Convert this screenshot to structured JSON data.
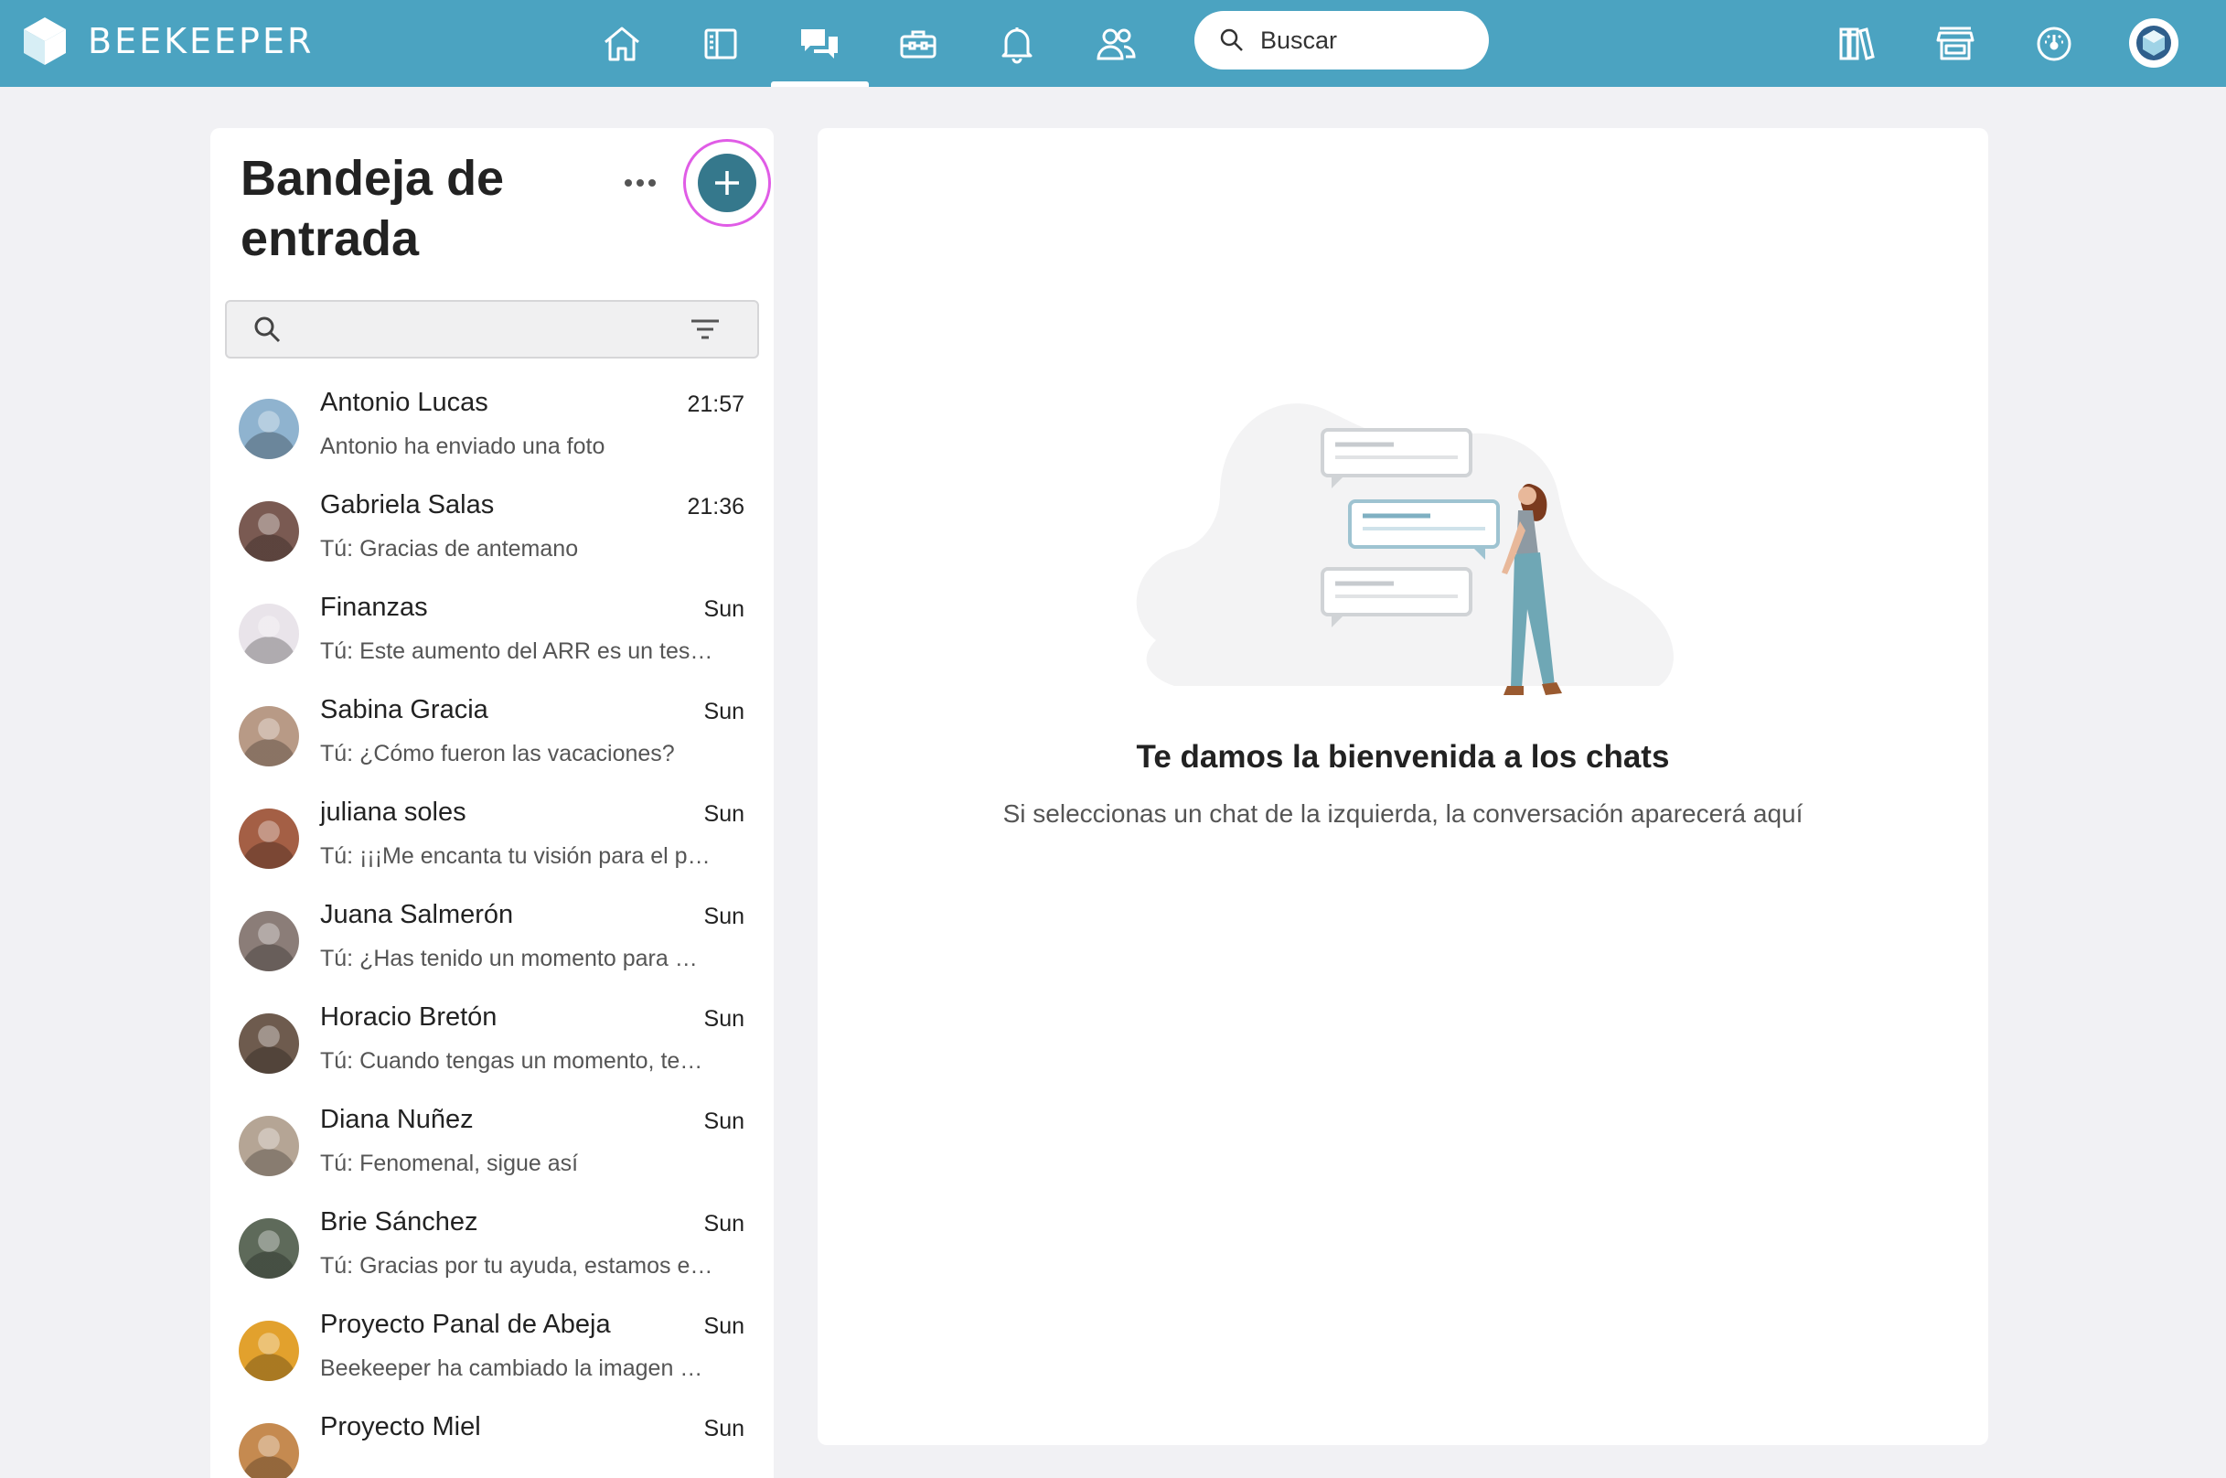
{
  "app": {
    "brand": "BEEKEEPER"
  },
  "topbar": {
    "nav": [
      {
        "id": "home",
        "icon": "home-icon"
      },
      {
        "id": "streams",
        "icon": "streams-icon"
      },
      {
        "id": "chats",
        "icon": "chat-icon",
        "active": true
      },
      {
        "id": "tools",
        "icon": "toolbox-icon"
      },
      {
        "id": "notifications",
        "icon": "bell-icon"
      },
      {
        "id": "people",
        "icon": "people-icon"
      }
    ],
    "search_placeholder": "Buscar",
    "right_icons": [
      "library-icon",
      "store-icon",
      "dashboard-icon",
      "profile-avatar"
    ],
    "accent": "#4ba3c1"
  },
  "inbox": {
    "title": "Bandeja de entrada",
    "search_value": "",
    "chats": [
      {
        "name": "Antonio Lucas",
        "time": "21:57",
        "preview": "Antonio ha enviado una foto",
        "avatar_color": "#8fb3cf"
      },
      {
        "name": "Gabriela Salas",
        "time": "21:36",
        "preview": "Tú: Gracias de antemano",
        "avatar_color": "#7a5a52"
      },
      {
        "name": "Finanzas",
        "time": "Sun",
        "preview": "Tú: Este aumento del ARR es un testi…",
        "avatar_color": "#e9e4ea"
      },
      {
        "name": "Sabina Gracia",
        "time": "Sun",
        "preview": "Tú: ¿Cómo fueron las vacaciones?",
        "avatar_color": "#b89a86"
      },
      {
        "name": "juliana soles",
        "time": "Sun",
        "preview": "Tú: ¡¡¡Me encanta tu visión para el pr…",
        "avatar_color": "#a45f45"
      },
      {
        "name": "Juana Salmerón",
        "time": "Sun",
        "preview": "Tú: ¿Has tenido un momento para …",
        "avatar_color": "#8b7d78"
      },
      {
        "name": "Horacio Bretón",
        "time": "Sun",
        "preview": "Tú: Cuando tengas un momento, te…",
        "avatar_color": "#6e5b4e"
      },
      {
        "name": "Diana Nuñez",
        "time": "Sun",
        "preview": "Tú: Fenomenal, sigue así",
        "avatar_color": "#b5a595"
      },
      {
        "name": "Brie Sánchez",
        "time": "Sun",
        "preview": "Tú: Gracias por tu ayuda, estamos e…",
        "avatar_color": "#5e6a5a"
      },
      {
        "name": "Proyecto Panal de Abeja",
        "time": "Sun",
        "preview": "Beekeeper ha cambiado la imagen …",
        "avatar_color": "#e2a12d"
      },
      {
        "name": "Proyecto Miel",
        "time": "Sun",
        "preview": "",
        "avatar_color": "#c58a50"
      }
    ]
  },
  "main": {
    "welcome_title": "Te damos la bienvenida a los chats",
    "welcome_sub": "Si seleccionas un chat de la izquierda, la conversación aparecerá aquí"
  },
  "colors": {
    "new_chat_button": "#35788c",
    "highlight_ring": "#e05ce6"
  }
}
